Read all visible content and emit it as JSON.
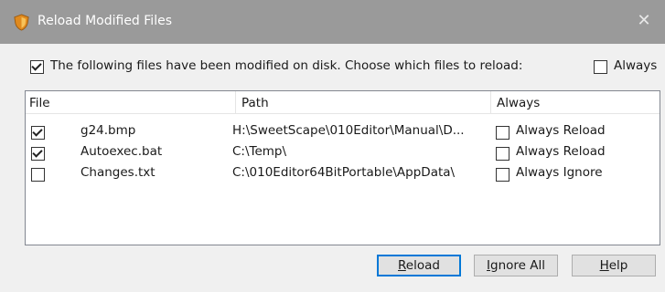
{
  "window": {
    "title": "Reload Modified Files",
    "close_glyph": "✕"
  },
  "prompt": {
    "checked": true,
    "text": "The following files have been modified on disk. Choose which files to reload:",
    "always_checked": false,
    "always_label": "Always"
  },
  "list": {
    "columns": [
      "File",
      "Path",
      "Always"
    ],
    "rows": [
      {
        "checked": true,
        "file": "g24.bmp",
        "path": "H:\\SweetScape\\010Editor\\Manual\\D...",
        "always_checked": false,
        "always": "Always Reload"
      },
      {
        "checked": true,
        "file": "Autoexec.bat",
        "path": "C:\\Temp\\",
        "always_checked": false,
        "always": "Always Reload"
      },
      {
        "checked": false,
        "file": "Changes.txt",
        "path": "C:\\010Editor64BitPortable\\AppData\\",
        "always_checked": false,
        "always": "Always Ignore"
      }
    ]
  },
  "buttons": {
    "reload": {
      "first": "R",
      "rest": "eload"
    },
    "ignore_all": {
      "first": "I",
      "rest": "gnore All"
    },
    "help": {
      "first": "H",
      "rest": "elp"
    }
  },
  "colors": {
    "titlebar": "#9a9a9a",
    "default_button_border": "#0078d7",
    "window_background": "#f0f0f0"
  },
  "icons": {
    "app": "shield-icon",
    "close": "close-icon"
  }
}
